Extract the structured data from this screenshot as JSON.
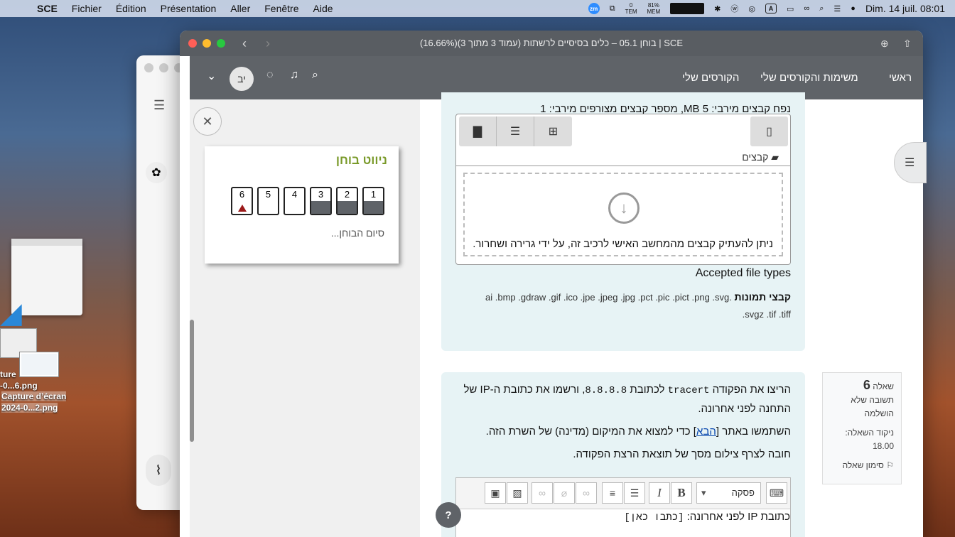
{
  "menubar": {
    "app": "SCE",
    "items": [
      "Fichier",
      "Édition",
      "Présentation",
      "Aller",
      "Fenêtre",
      "Aide"
    ],
    "temp_value": "0",
    "temp_label": "TEM",
    "mem_value": "81%",
    "mem_label": "MEM",
    "datetime": "Dim. 14 juil.  08:01",
    "zoom": "zm",
    "input_label": "A",
    "stat_letters": "S\nC\nJ"
  },
  "desktop": {
    "file1_prefix": "ture",
    "file1_mid": "-0...6.png",
    "file2_name": "Capture d’écran",
    "file2_mid": "2024-0...2.png"
  },
  "window": {
    "title": "(16.66%)בוחן 05.1 – כלים בסיסיים לרשתות (עמוד 3 מתוך 3) | SCE"
  },
  "nav": {
    "home": "ראשי",
    "tasks": "משימות והקורסים שלי",
    "courses": "הקורסים שלי",
    "avatar": "יב"
  },
  "quiznav": {
    "title": "ניווט בוחן",
    "questions": [
      "1",
      "2",
      "3",
      "4",
      "5",
      "6"
    ],
    "answered": [
      true,
      true,
      true,
      false,
      false,
      false
    ],
    "flagged": [
      false,
      false,
      false,
      false,
      false,
      true
    ],
    "finish": "סיום הבוחן..."
  },
  "filepicker": {
    "max_size": "נפח קבצים מירבי: 5 MB, מספר קבצים מצורפים מירבי: 1",
    "breadcrumb": "קבצים",
    "drop_text": "ניתן להעתיק קבצים מהמחשב האישי לרכיב זה, על ידי גרירה ושחרור.",
    "accepted_title": "Accepted file types",
    "types_label": "קבצי תמונות",
    "types_list": " .ai .bmp .gdraw .gif .ico .jpe .jpeg .jpg .pct .pic .pict .png .svg .svgz .tif .tiff"
  },
  "question6": {
    "label": "שאלה",
    "number": "6",
    "status": "תשובה שלא הושלמה",
    "grade_label": "ניקוד השאלה:",
    "grade": "18.00",
    "flag": "סימון שאלה",
    "text1a": "הריצו את הפקודה ",
    "cmd": "tracert",
    "text1b": " לכתובת ",
    "ip": "8.8.8.8",
    "text1c": ", ורשמו את כתובת ה-IP של התחנה לפני אחרונה.",
    "text2a": "השתמשו באתר [",
    "link": "הבא",
    "text2b": "] כדי למצוא את המיקום (מדינה) של השרת הזה.",
    "text3": "חובה לצרף צילום מסך של תוצאת הרצת הפקודה.",
    "para_select": "פסקה",
    "answer_label": "כתובת IP לפני אחרונה: ",
    "answer_placeholder": "[כתבו כאן]"
  },
  "help": "?"
}
